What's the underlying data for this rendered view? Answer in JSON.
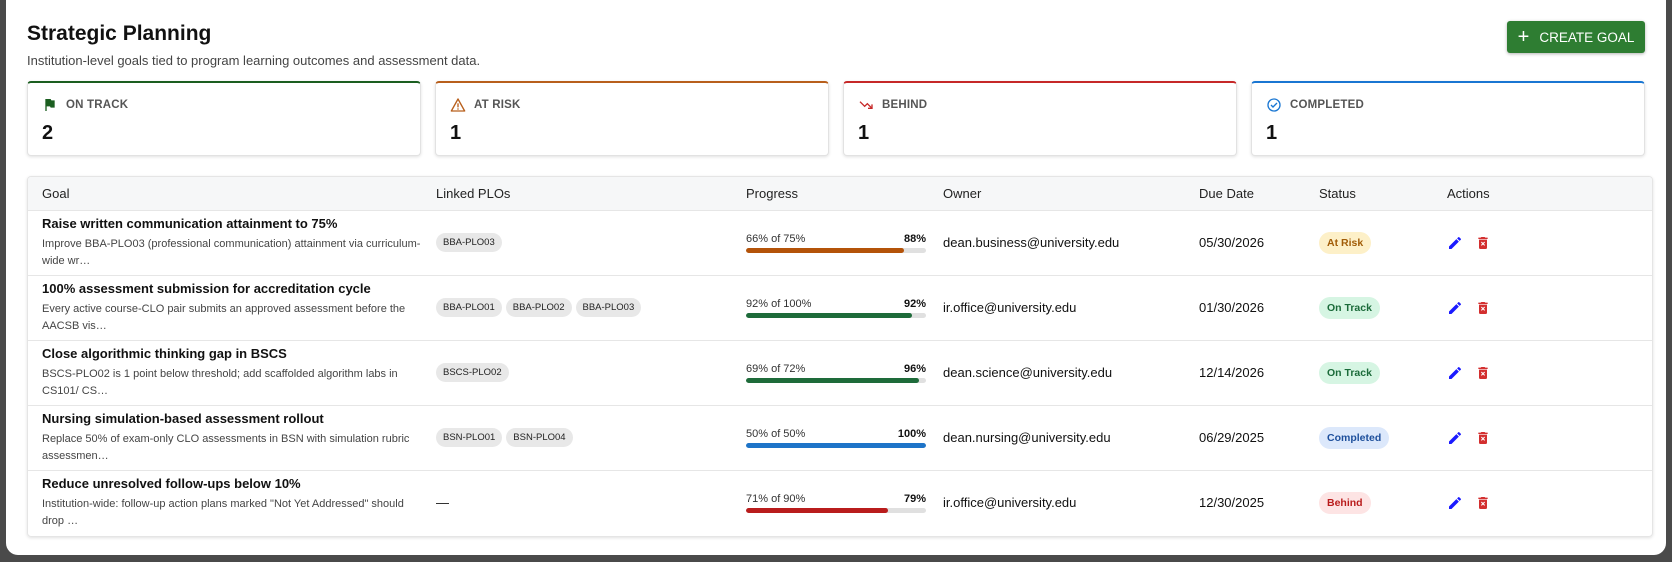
{
  "header": {
    "title": "Strategic Planning",
    "subtitle": "Institution-level goals tied to program learning outcomes and assessment data.",
    "create_label": "CREATE GOAL"
  },
  "cards": [
    {
      "label": "ON TRACK",
      "value": "2",
      "icon": "flag-icon",
      "color": "#1b5e20"
    },
    {
      "label": "AT RISK",
      "value": "1",
      "icon": "warning-icon",
      "color": "#b85f1c"
    },
    {
      "label": "BEHIND",
      "value": "1",
      "icon": "trending-down-icon",
      "color": "#c62828"
    },
    {
      "label": "COMPLETED",
      "value": "1",
      "icon": "check-circle-icon",
      "color": "#1976d2"
    }
  ],
  "table": {
    "columns": [
      "Goal",
      "Linked PLOs",
      "Progress",
      "Owner",
      "Due Date",
      "Status",
      "Actions"
    ],
    "rows": [
      {
        "title": "Raise written communication attainment to 75%",
        "desc": "Improve BBA-PLO03 (professional communication) attainment via curriculum-wide wr…",
        "plos": [
          "BBA-PLO03"
        ],
        "progress_label": "66% of 75%",
        "progress_pct": "88%",
        "progress_value": 88,
        "bar_color": "#b45309",
        "owner": "dean.business@university.edu",
        "due": "05/30/2026",
        "status": "At Risk",
        "status_bg": "#fdf0c8",
        "status_fg": "#a15c07"
      },
      {
        "title": "100% assessment submission for accreditation cycle",
        "desc": "Every active course-CLO pair submits an approved assessment before the AACSB vis…",
        "plos": [
          "BBA-PLO01",
          "BBA-PLO02",
          "BBA-PLO03"
        ],
        "progress_label": "92% of 100%",
        "progress_pct": "92%",
        "progress_value": 92,
        "bar_color": "#1e6b3a",
        "owner": "ir.office@university.edu",
        "due": "01/30/2026",
        "status": "On Track",
        "status_bg": "#d6f5e3",
        "status_fg": "#1b6b3a"
      },
      {
        "title": "Close algorithmic thinking gap in BSCS",
        "desc": "BSCS-PLO02 is 1 point below threshold; add scaffolded algorithm labs in CS101/ CS…",
        "plos": [
          "BSCS-PLO02"
        ],
        "progress_label": "69% of 72%",
        "progress_pct": "96%",
        "progress_value": 96,
        "bar_color": "#1e6b3a",
        "owner": "dean.science@university.edu",
        "due": "12/14/2026",
        "status": "On Track",
        "status_bg": "#d6f5e3",
        "status_fg": "#1b6b3a"
      },
      {
        "title": "Nursing simulation-based assessment rollout",
        "desc": "Replace 50% of exam-only CLO assessments in BSN with simulation rubric assessmen…",
        "plos": [
          "BSN-PLO01",
          "BSN-PLO04"
        ],
        "progress_label": "50% of 50%",
        "progress_pct": "100%",
        "progress_value": 100,
        "bar_color": "#1e74c8",
        "owner": "dean.nursing@university.edu",
        "due": "06/29/2025",
        "status": "Completed",
        "status_bg": "#dce8fb",
        "status_fg": "#1d4f9c"
      },
      {
        "title": "Reduce unresolved follow-ups below 10%",
        "desc": "Institution-wide: follow-up action plans marked \"Not Yet Addressed\" should drop …",
        "plos": [],
        "plos_empty": "—",
        "progress_label": "71% of 90%",
        "progress_pct": "79%",
        "progress_value": 79,
        "bar_color": "#b91c1c",
        "owner": "ir.office@university.edu",
        "due": "12/30/2025",
        "status": "Behind",
        "status_bg": "#fde4e4",
        "status_fg": "#b91c1c"
      }
    ]
  }
}
